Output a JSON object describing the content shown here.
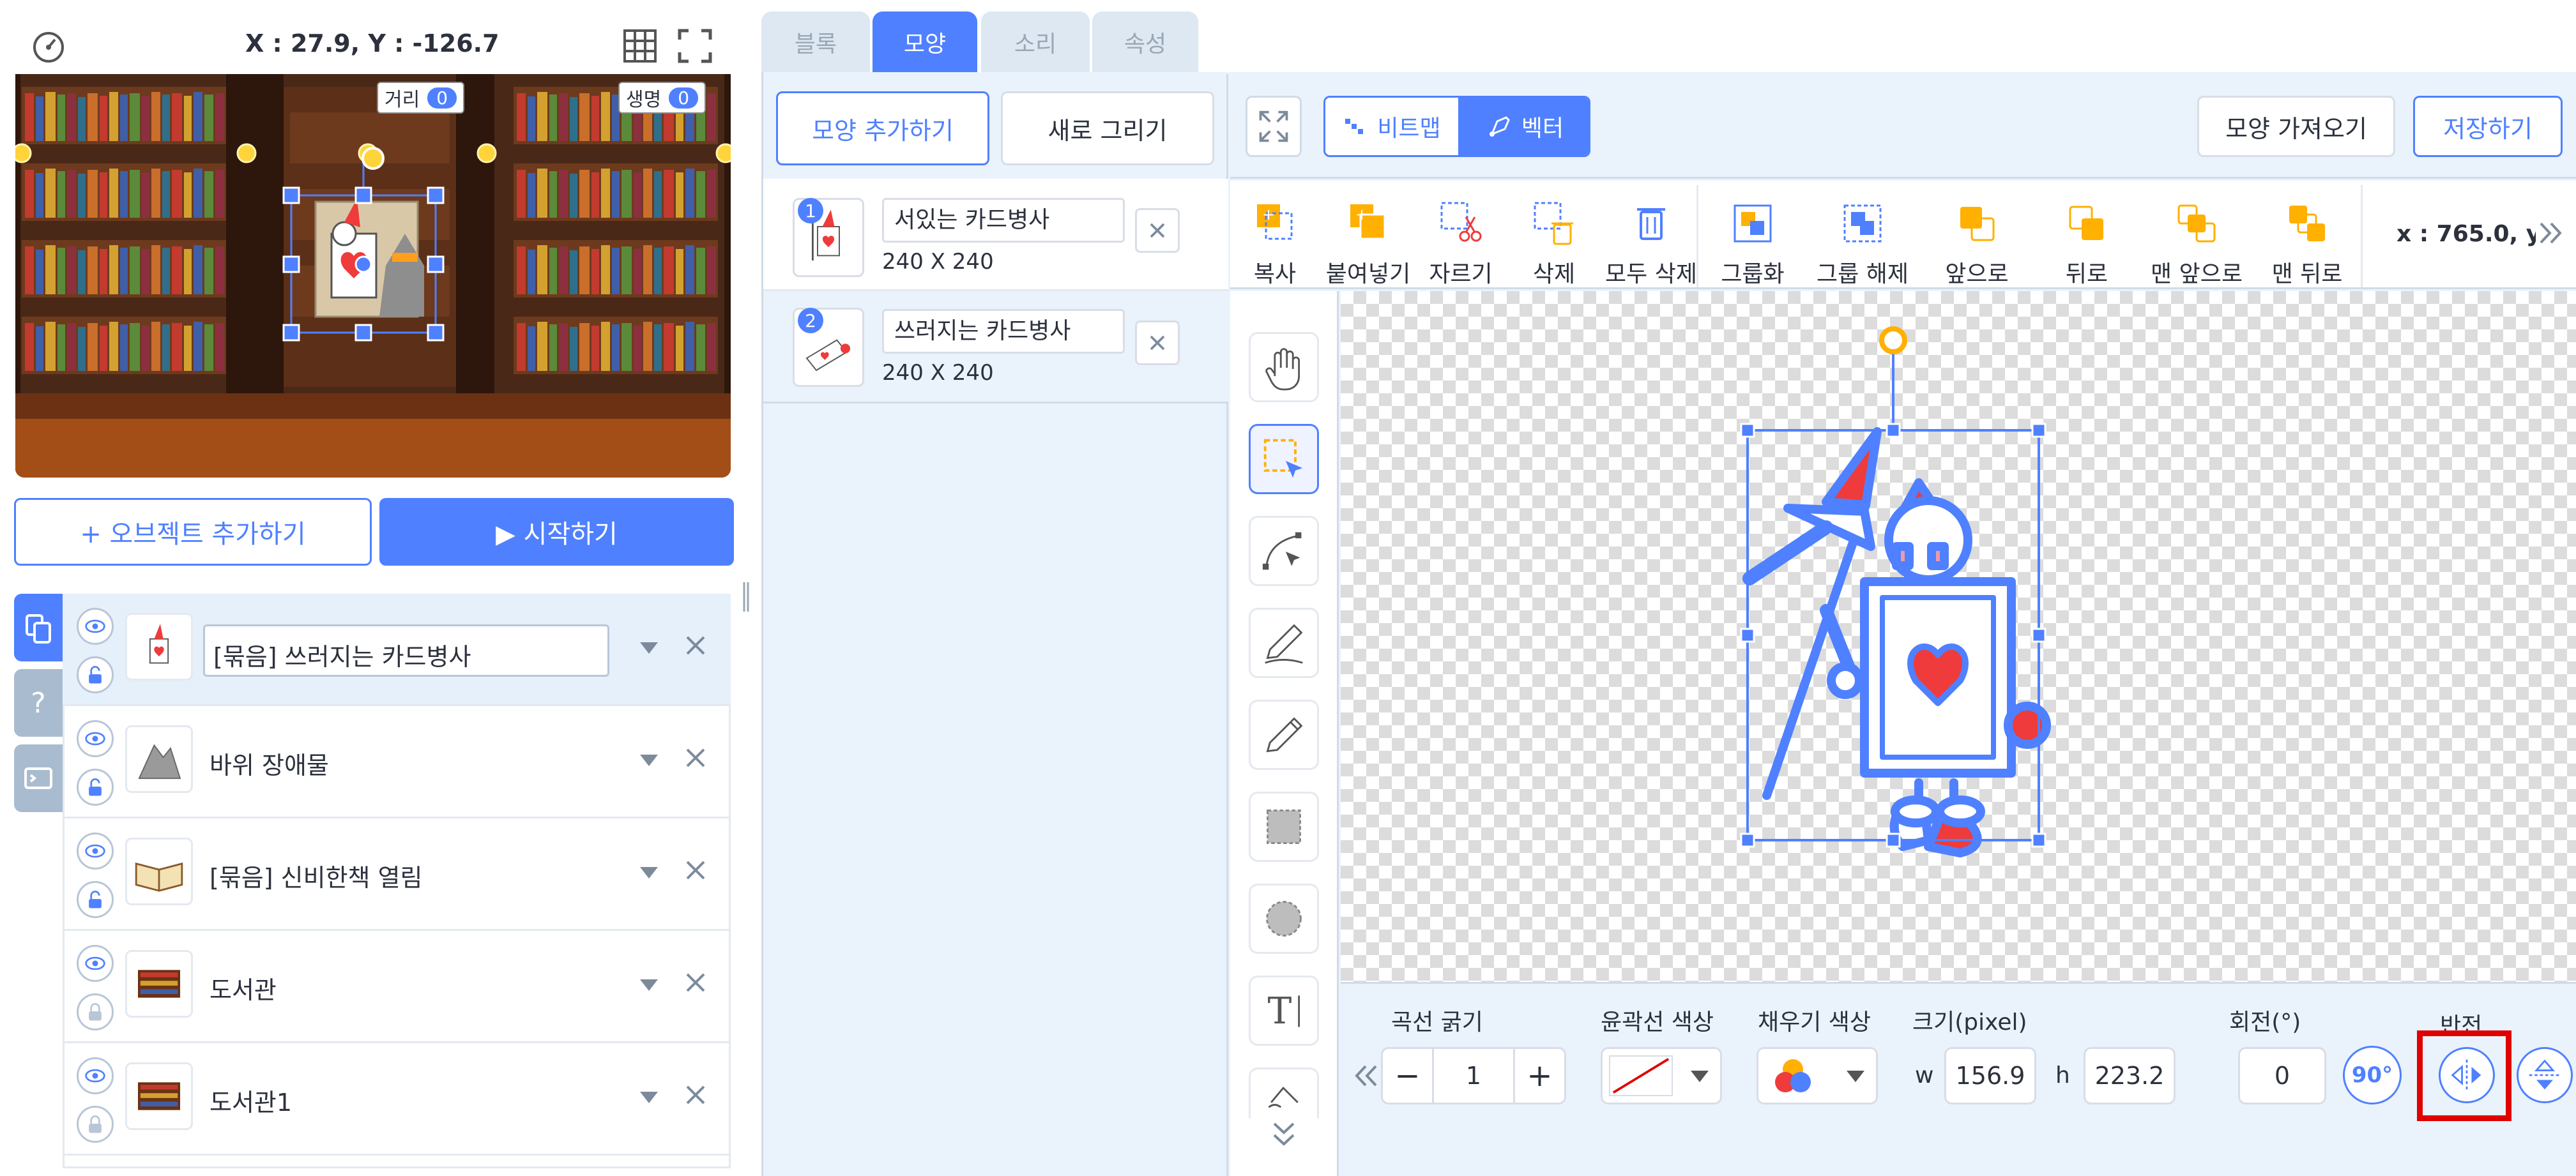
{
  "stage": {
    "coords": "X : 27.9, Y : -126.7",
    "var_distance_label": "거리",
    "var_distance_value": "0",
    "var_life_label": "생명",
    "var_life_value": "0"
  },
  "actions": {
    "add_object": "+ 오브젝트 추가하기",
    "start": "▶ 시작하기"
  },
  "objects": [
    {
      "name": "[묶음] 쓰러지는 카드병사",
      "selected": true
    },
    {
      "name": "바위 장애물"
    },
    {
      "name": "[묶음] 신비한책 열림"
    },
    {
      "name": "도서관"
    },
    {
      "name": "도서관1"
    }
  ],
  "tabs": [
    "블록",
    "모양",
    "소리",
    "속성"
  ],
  "shape_panel": {
    "add_shape": "모양 추가하기",
    "new_draw": "새로 그리기",
    "shapes": [
      {
        "num": "1",
        "name": "서있는 카드병사",
        "size": "240 X 240"
      },
      {
        "num": "2",
        "name": "쓰러지는 카드병사",
        "size": "240 X 240"
      }
    ]
  },
  "editor": {
    "mode_bitmap": "비트맵",
    "mode_vector": "벡터",
    "import_shape": "모양 가져오기",
    "save": "저장하기",
    "coord_readout": "x : 765.0, y",
    "toolbar": [
      "복사",
      "붙여넣기",
      "자르기",
      "삭제",
      "모두 삭제",
      "그룹화",
      "그룹 해제",
      "앞으로",
      "뒤로",
      "맨 앞으로",
      "맨 뒤로"
    ],
    "props": {
      "stroke_width_label": "곡선 굵기",
      "stroke_width_value": "1",
      "stroke_color_label": "윤곽선 색상",
      "fill_color_label": "채우기 색상",
      "size_label": "크기(pixel)",
      "w_label": "w",
      "w_value": "156.9",
      "h_label": "h",
      "h_value": "223.2",
      "rotation_label": "회전(°)",
      "rotation_value": "0",
      "rotate90": "90°",
      "flip_label": "반전",
      "minus": "−",
      "plus": "+"
    }
  },
  "colors": {
    "accent": "#4f80ff",
    "highlight": "#e00000",
    "heart": "#ef3b3b"
  }
}
